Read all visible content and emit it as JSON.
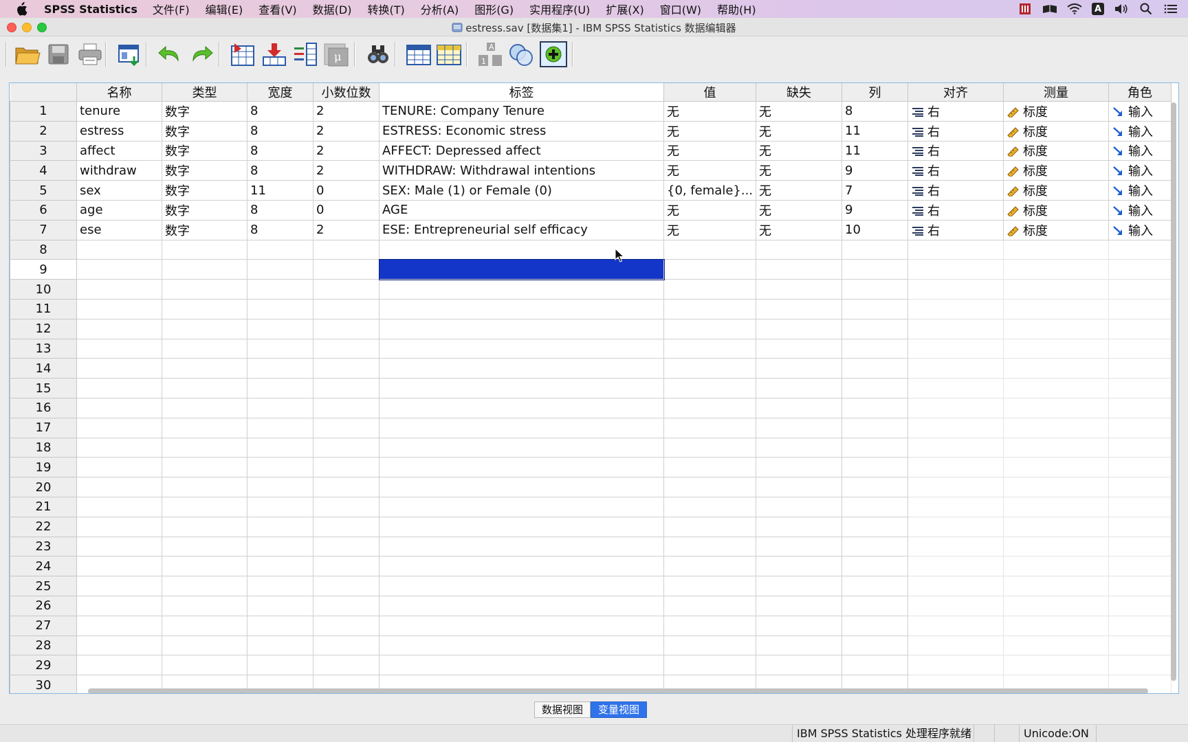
{
  "menubar": {
    "app_name": "SPSS Statistics",
    "menus": [
      "文件(F)",
      "编辑(E)",
      "查看(V)",
      "数据(D)",
      "转换(T)",
      "分析(A)",
      "图形(G)",
      "实用程序(U)",
      "扩展(X)",
      "窗口(W)",
      "帮助(H)"
    ],
    "status_icons": [
      "spss-app-icon",
      "book-icon",
      "wifi-icon",
      "input-method-icon",
      "volume-icon",
      "search-icon",
      "list-icon"
    ],
    "input_method_label": "A"
  },
  "window": {
    "title": "estress.sav [数据集1] - IBM SPSS Statistics 数据编辑器"
  },
  "toolbar": {
    "buttons": [
      "open-icon",
      "save-icon",
      "print-icon",
      "recall-dialog-icon",
      "undo-icon",
      "redo-icon",
      "goto-case-icon",
      "goto-variable-icon",
      "variables-icon",
      "run-descriptives-icon",
      "find-icon",
      "insert-cases-icon",
      "insert-variable-icon",
      "split-file-icon",
      "select-cases-icon",
      "value-labels-icon"
    ],
    "value_label_text": "1 A"
  },
  "grid": {
    "columns": [
      "名称",
      "类型",
      "宽度",
      "小数位数",
      "标签",
      "值",
      "缺失",
      "列",
      "对齐",
      "测量",
      "角色"
    ],
    "rows": [
      {
        "num": "1",
        "name": "tenure",
        "type": "数字",
        "width": "8",
        "decimals": "2",
        "label": "TENURE: Company Tenure",
        "values": "无",
        "missing": "无",
        "columns": "8",
        "align": "右",
        "measure": "标度",
        "role": "输入"
      },
      {
        "num": "2",
        "name": "estress",
        "type": "数字",
        "width": "8",
        "decimals": "2",
        "label": "ESTRESS: Economic stress",
        "values": "无",
        "missing": "无",
        "columns": "11",
        "align": "右",
        "measure": "标度",
        "role": "输入"
      },
      {
        "num": "3",
        "name": "affect",
        "type": "数字",
        "width": "8",
        "decimals": "2",
        "label": "AFFECT: Depressed affect",
        "values": "无",
        "missing": "无",
        "columns": "11",
        "align": "右",
        "measure": "标度",
        "role": "输入"
      },
      {
        "num": "4",
        "name": "withdraw",
        "type": "数字",
        "width": "8",
        "decimals": "2",
        "label": "WITHDRAW: Withdrawal intentions",
        "values": "无",
        "missing": "无",
        "columns": "9",
        "align": "右",
        "measure": "标度",
        "role": "输入"
      },
      {
        "num": "5",
        "name": "sex",
        "type": "数字",
        "width": "11",
        "decimals": "0",
        "label": "SEX: Male (1) or Female (0)",
        "values": "{0, female}...",
        "missing": "无",
        "columns": "7",
        "align": "右",
        "measure": "标度",
        "role": "输入"
      },
      {
        "num": "6",
        "name": "age",
        "type": "数字",
        "width": "8",
        "decimals": "0",
        "label": "AGE",
        "values": "无",
        "missing": "无",
        "columns": "9",
        "align": "右",
        "measure": "标度",
        "role": "输入"
      },
      {
        "num": "7",
        "name": "ese",
        "type": "数字",
        "width": "8",
        "decimals": "2",
        "label": "ESE: Entrepreneurial self efficacy",
        "values": "无",
        "missing": "无",
        "columns": "10",
        "align": "右",
        "measure": "标度",
        "role": "输入"
      }
    ],
    "empty_row_numbers": [
      "8",
      "9",
      "10",
      "11",
      "12",
      "13",
      "14",
      "15",
      "16",
      "17",
      "18",
      "19",
      "20",
      "21",
      "22",
      "23",
      "24",
      "25",
      "26",
      "27",
      "28",
      "29",
      "30"
    ],
    "selected_row": "9",
    "selected_column": "标签"
  },
  "view_tabs": {
    "data_view": "数据视图",
    "variable_view": "变量视图",
    "active": "变量视图"
  },
  "statusbar": {
    "processor": "IBM SPSS Statistics 处理程序就绪",
    "unicode": "Unicode:ON"
  },
  "colors": {
    "selection": "#1336c9",
    "active_tab": "#2f73ea",
    "frame_border": "#88b7e0"
  }
}
